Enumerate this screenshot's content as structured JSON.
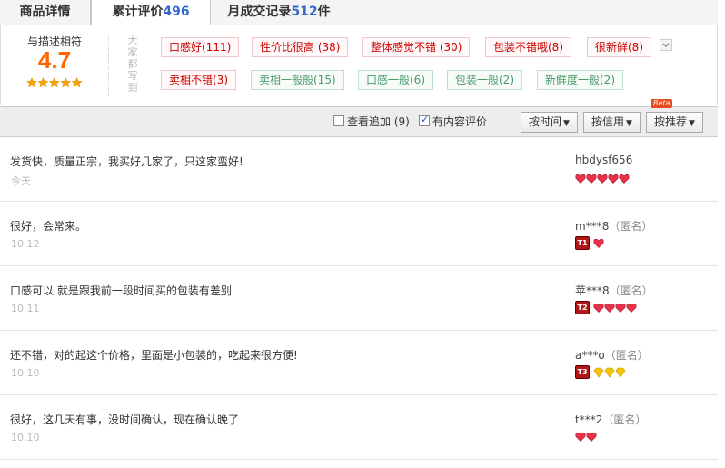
{
  "tabs": [
    {
      "label": "商品详情",
      "count": ""
    },
    {
      "label": "累计评价",
      "count": "496"
    },
    {
      "label": "月成交记录",
      "count": "512",
      "suffix": "件"
    }
  ],
  "summary": {
    "score_label": "与描述相符",
    "score": "4.7",
    "star_rating": 4.7,
    "vertical_label": "大家都写到",
    "tags_positive": [
      "口感好(111)",
      "性价比很高 (38)",
      "整体感觉不错 (30)",
      "包装不错哦(8)",
      "很新鲜(8)",
      "卖相不错(3)"
    ],
    "tags_neutral": [
      "卖相一般般(15)",
      "口感一般(6)",
      "包装一般(2)",
      "新鲜度一般(2)"
    ]
  },
  "toolbar": {
    "append_label": "查看追加 (9)",
    "append_checked": false,
    "content_label": "有内容评价",
    "content_checked": true,
    "sort_time": "按时间",
    "sort_credit": "按信用",
    "sort_recommend": "按推荐",
    "beta": "Beta"
  },
  "colors": {
    "score": "#ff6600",
    "count": "#3366cc",
    "heart": "#e8334a",
    "diamond": "#f5c400"
  },
  "reviews": [
    {
      "content": "发货快，质量正宗，我买好几家了，只这家蛮好!",
      "date": "今天",
      "user": "hbdysf656",
      "anon": "",
      "vip": "",
      "rank_type": "heart",
      "rank_count": 5
    },
    {
      "content": "很好，会常来。",
      "date": "10.12",
      "user": "m***8",
      "anon": "（匿名）",
      "vip": "T1",
      "rank_type": "heart",
      "rank_count": 1
    },
    {
      "content": "口感可以 就是跟我前一段时间买的包装有差别",
      "date": "10.11",
      "user": "苹***8",
      "anon": "（匿名）",
      "vip": "T2",
      "rank_type": "heart",
      "rank_count": 4
    },
    {
      "content": "还不错，对的起这个价格，里面是小包装的，吃起来很方便!",
      "date": "10.10",
      "user": "a***o",
      "anon": "（匿名）",
      "vip": "T3",
      "rank_type": "diamond",
      "rank_count": 3
    },
    {
      "content": "很好，这几天有事，没时间确认，现在确认晚了",
      "date": "10.10",
      "user": "t***2",
      "anon": "（匿名）",
      "vip": "",
      "rank_type": "heart",
      "rank_count": 2
    }
  ]
}
